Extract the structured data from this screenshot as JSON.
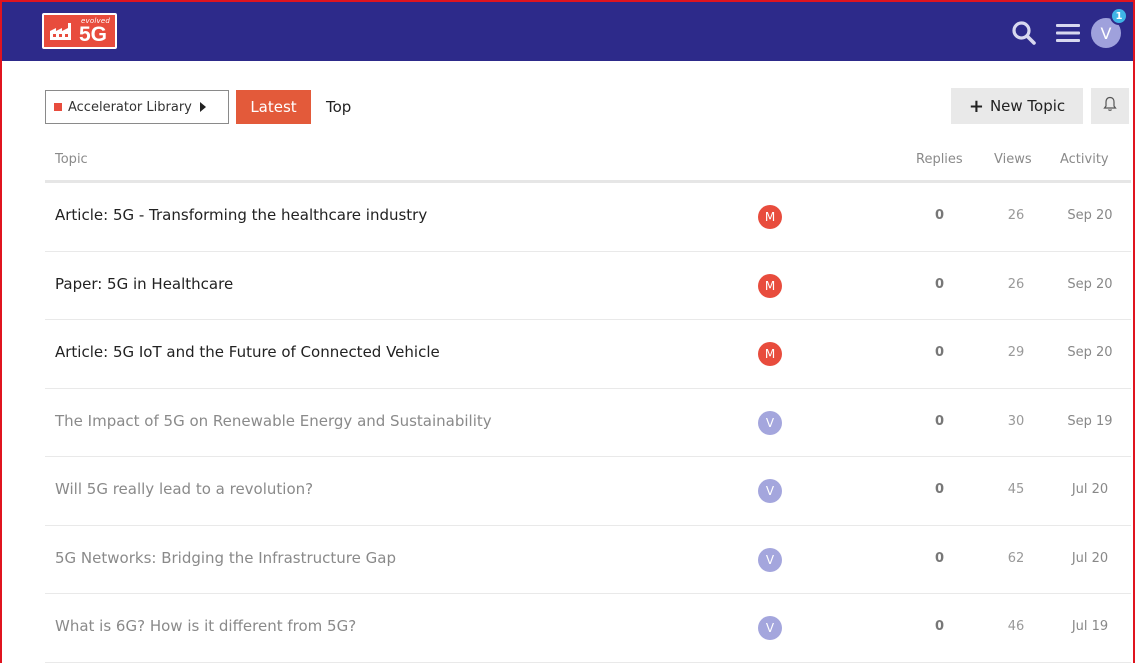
{
  "header": {
    "logo_small": "evolved",
    "logo_big": "5G",
    "avatar_letter": "V",
    "notification_count": "1",
    "brand_color": "#2d2a8a",
    "accent_color": "#e84c3d"
  },
  "nav": {
    "category_label": "Accelerator Library",
    "tab_latest": "Latest",
    "tab_top": "Top",
    "new_topic_label": "New Topic"
  },
  "table": {
    "columns": [
      "Topic",
      "Replies",
      "Views",
      "Activity"
    ],
    "rows": [
      {
        "title": "Article: 5G - Transforming the healthcare industry",
        "poster": "M",
        "poster_color": "#e84c3d",
        "replies": "0",
        "views": "26",
        "activity": "Sep 20",
        "read": false
      },
      {
        "title": "Paper: 5G in Healthcare",
        "poster": "M",
        "poster_color": "#e84c3d",
        "replies": "0",
        "views": "26",
        "activity": "Sep 20",
        "read": false
      },
      {
        "title": "Article: 5G IoT and the Future of Connected Vehicle",
        "poster": "M",
        "poster_color": "#e84c3d",
        "replies": "0",
        "views": "29",
        "activity": "Sep 20",
        "read": false
      },
      {
        "title": "The Impact of 5G on Renewable Energy and Sustainability",
        "poster": "V",
        "poster_color": "#a4a6dd",
        "replies": "0",
        "views": "30",
        "activity": "Sep 19",
        "read": true
      },
      {
        "title": "Will 5G really lead to a revolution?",
        "poster": "V",
        "poster_color": "#a4a6dd",
        "replies": "0",
        "views": "45",
        "activity": "Jul 20",
        "read": true
      },
      {
        "title": "5G Networks: Bridging the Infrastructure Gap",
        "poster": "V",
        "poster_color": "#a4a6dd",
        "replies": "0",
        "views": "62",
        "activity": "Jul 20",
        "read": true
      },
      {
        "title": "What is 6G? How is it different from 5G?",
        "poster": "V",
        "poster_color": "#a4a6dd",
        "replies": "0",
        "views": "46",
        "activity": "Jul 19",
        "read": true
      }
    ]
  }
}
